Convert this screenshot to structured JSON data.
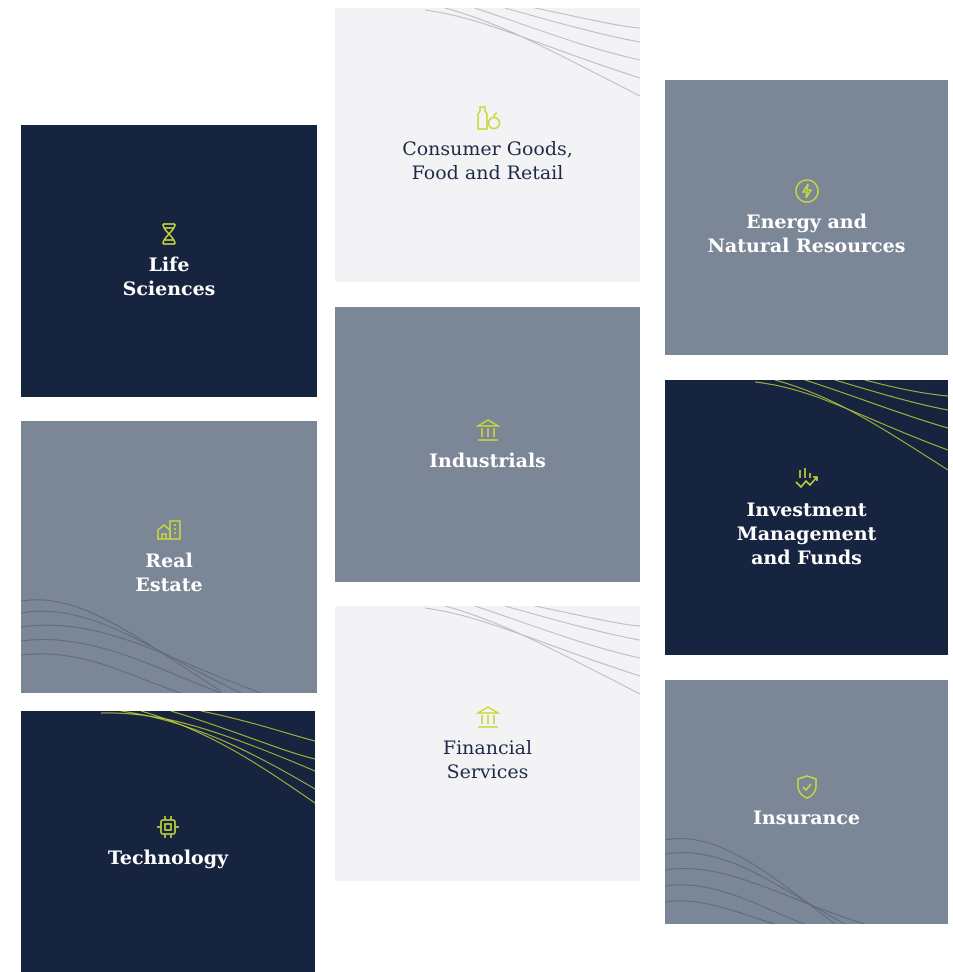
{
  "colors": {
    "navy": "#172440",
    "slate": "#7b8697",
    "light": "#f3f3f5",
    "accent": "#c8d83a"
  },
  "tiles": [
    {
      "id": "life-sciences",
      "label": "Life\nSciences",
      "icon": "dna-icon"
    },
    {
      "id": "real-estate",
      "label": "Real\nEstate",
      "icon": "buildings-icon"
    },
    {
      "id": "technology",
      "label": "Technology",
      "icon": "chip-icon"
    },
    {
      "id": "consumer-goods",
      "label": "Consumer Goods,\nFood and Retail",
      "icon": "bottle-apple-icon"
    },
    {
      "id": "industrials",
      "label": "Industrials",
      "icon": "building-columns-icon"
    },
    {
      "id": "financial-services",
      "label": "Financial\nServices",
      "icon": "bank-icon"
    },
    {
      "id": "energy",
      "label": "Energy and\nNatural Resources",
      "icon": "lightning-circle-icon"
    },
    {
      "id": "investment",
      "label": "Investment\nManagement\nand Funds",
      "icon": "chart-arrow-icon"
    },
    {
      "id": "insurance",
      "label": "Insurance",
      "icon": "shield-check-icon"
    }
  ]
}
